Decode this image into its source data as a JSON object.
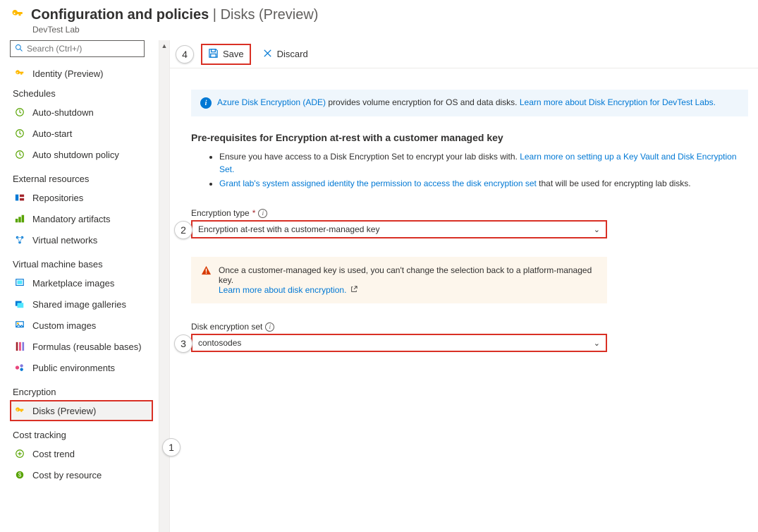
{
  "header": {
    "title": "Configuration and policies",
    "context": "Disks (Preview)",
    "subtitle": "DevTest Lab"
  },
  "search": {
    "placeholder": "Search (Ctrl+/)"
  },
  "nav": {
    "top_item": "Identity (Preview)",
    "groups": {
      "schedules": {
        "label": "Schedules",
        "items": [
          "Auto-shutdown",
          "Auto-start",
          "Auto shutdown policy"
        ]
      },
      "external": {
        "label": "External resources",
        "items": [
          "Repositories",
          "Mandatory artifacts",
          "Virtual networks"
        ]
      },
      "vmbases": {
        "label": "Virtual machine bases",
        "items": [
          "Marketplace images",
          "Shared image galleries",
          "Custom images",
          "Formulas (reusable bases)",
          "Public environments"
        ]
      },
      "encryption": {
        "label": "Encryption",
        "items": [
          "Disks (Preview)"
        ]
      },
      "cost": {
        "label": "Cost tracking",
        "items": [
          "Cost trend",
          "Cost by resource"
        ]
      }
    }
  },
  "toolbar": {
    "save": "Save",
    "discard": "Discard"
  },
  "callouts": {
    "n1": "1",
    "n2": "2",
    "n3": "3",
    "n4": "4"
  },
  "info_banner": {
    "link1": "Azure Disk Encryption (ADE)",
    "middle": " provides volume encryption for OS and data disks. ",
    "link2": "Learn more about Disk Encryption for DevTest Labs."
  },
  "section_heading": "Pre-requisites for Encryption at-rest with a customer managed key",
  "bullets": {
    "b1_pre": "Ensure you have access to a Disk Encryption Set to encrypt your lab disks with. ",
    "b1_link": "Learn more on setting up a Key Vault and Disk Encryption Set.",
    "b2_link": "Grant lab's system assigned identity the permission to access the disk encryption set",
    "b2_post": " that will be used for encrypting lab disks."
  },
  "fields": {
    "encryption_type": {
      "label": "Encryption type",
      "value": "Encryption at-rest with a customer-managed key"
    },
    "disk_encryption_set": {
      "label": "Disk encryption set",
      "value": "contosodes"
    }
  },
  "warning": {
    "text": "Once a customer-managed key is used, you can't change the selection back to a platform-managed key.",
    "link": "Learn more about disk encryption."
  }
}
